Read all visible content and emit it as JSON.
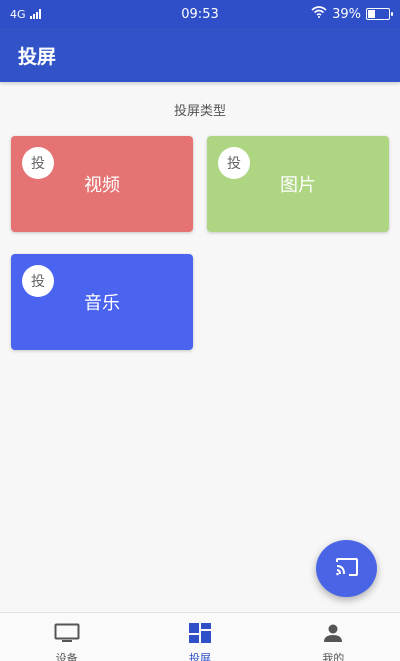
{
  "status_bar": {
    "network": "4G",
    "time": "09:53",
    "battery": "39%",
    "battery_level": 0.39
  },
  "app_bar": {
    "title": "投屏"
  },
  "section": {
    "title": "投屏类型"
  },
  "cards": [
    {
      "badge": "投",
      "label": "视频",
      "color": "#e57373"
    },
    {
      "badge": "投",
      "label": "图片",
      "color": "#aed581"
    },
    {
      "badge": "投",
      "label": "音乐",
      "color": "#4a64f0"
    }
  ],
  "fab": {
    "icon": "cast-icon",
    "color": "#4a64e6"
  },
  "bottom_nav": {
    "items": [
      {
        "label": "设备",
        "icon": "tv-icon",
        "active": false
      },
      {
        "label": "投屏",
        "icon": "dashboard-icon",
        "active": true
      },
      {
        "label": "我的",
        "icon": "person-icon",
        "active": false
      }
    ]
  },
  "colors": {
    "primary": "#3253c8",
    "inactive": "#555555"
  }
}
